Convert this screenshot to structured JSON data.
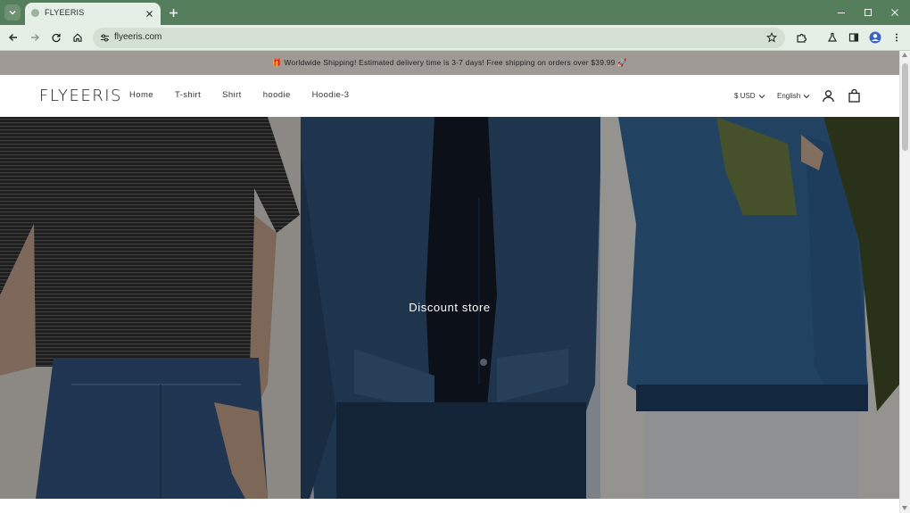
{
  "browser": {
    "tab_title": "FLYEERIS",
    "url": "flyeeris.com"
  },
  "announcement": {
    "text": "🎁 Worldwide Shipping! Estimated delivery time is 3-7 days! Free shipping on orders over $39.99 🚀"
  },
  "header": {
    "logo": "FLYEERIS",
    "nav": [
      "Home",
      "T-shirt",
      "Shirt",
      "hoodie",
      "Hoodie-3"
    ],
    "currency": "$ USD",
    "language": "English"
  },
  "hero": {
    "title": "Discount store"
  },
  "colors": {
    "browser_frame": "#557e5c",
    "toolbar": "#e6efe6",
    "announcement_bg": "#a09a97"
  }
}
